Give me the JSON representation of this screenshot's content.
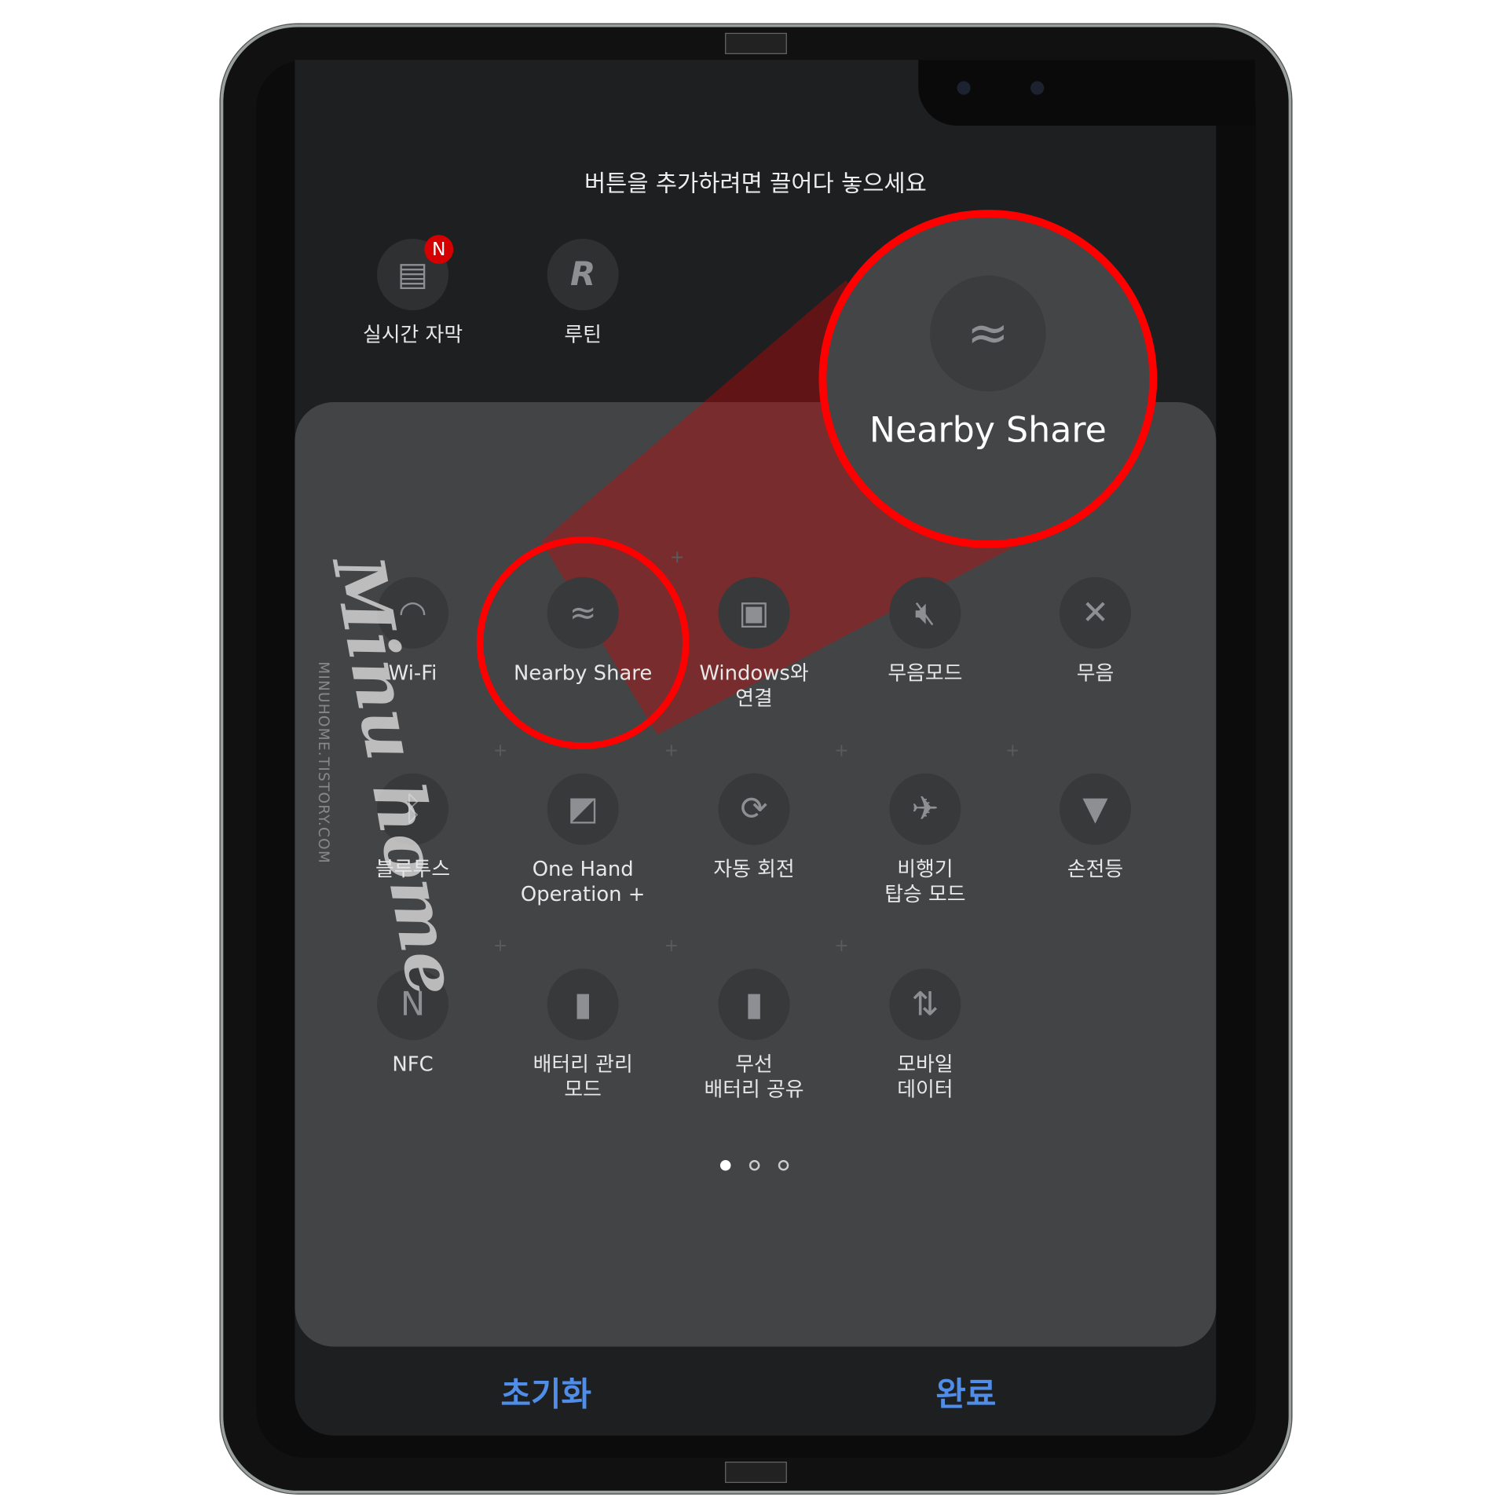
{
  "header": {
    "instruction": "버튼을 추가하려면 끌어다 놓으세요"
  },
  "available": [
    {
      "label": "실시간 자막",
      "icon": "live-caption-icon",
      "badge": "N"
    },
    {
      "label": "루틴",
      "icon": "routine-icon"
    }
  ],
  "tiles": [
    {
      "label": "Wi-Fi",
      "icon": "wifi-icon"
    },
    {
      "label": "Nearby Share",
      "icon": "nearby-share-icon"
    },
    {
      "label": "Windows와\n연결",
      "icon": "link-to-windows-icon"
    },
    {
      "label": "무음모드",
      "icon": "mute-mode-icon"
    },
    {
      "label": "무음",
      "icon": "mute-icon"
    },
    {
      "label": "블루투스",
      "icon": "bluetooth-icon"
    },
    {
      "label": "One Hand\nOperation +",
      "icon": "one-hand-icon"
    },
    {
      "label": "자동 회전",
      "icon": "auto-rotate-icon"
    },
    {
      "label": "비행기\n탑승 모드",
      "icon": "airplane-icon"
    },
    {
      "label": "손전등",
      "icon": "flashlight-icon"
    },
    {
      "label": "NFC",
      "icon": "nfc-icon"
    },
    {
      "label": "배터리 관리\n모드",
      "icon": "battery-saver-icon"
    },
    {
      "label": "무선\n배터리 공유",
      "icon": "wireless-powershare-icon"
    },
    {
      "label": "모바일\n데이터",
      "icon": "mobile-data-icon"
    }
  ],
  "callout": {
    "label": "Nearby Share",
    "color": "#ff0000"
  },
  "pagination": {
    "pages": 3,
    "current": 1
  },
  "footer": {
    "reset_label": "초기화",
    "done_label": "완료",
    "accent": "#4f8de8"
  },
  "watermark": {
    "script": "Minu home",
    "url": "MINUHOME.TISTORY.COM"
  }
}
